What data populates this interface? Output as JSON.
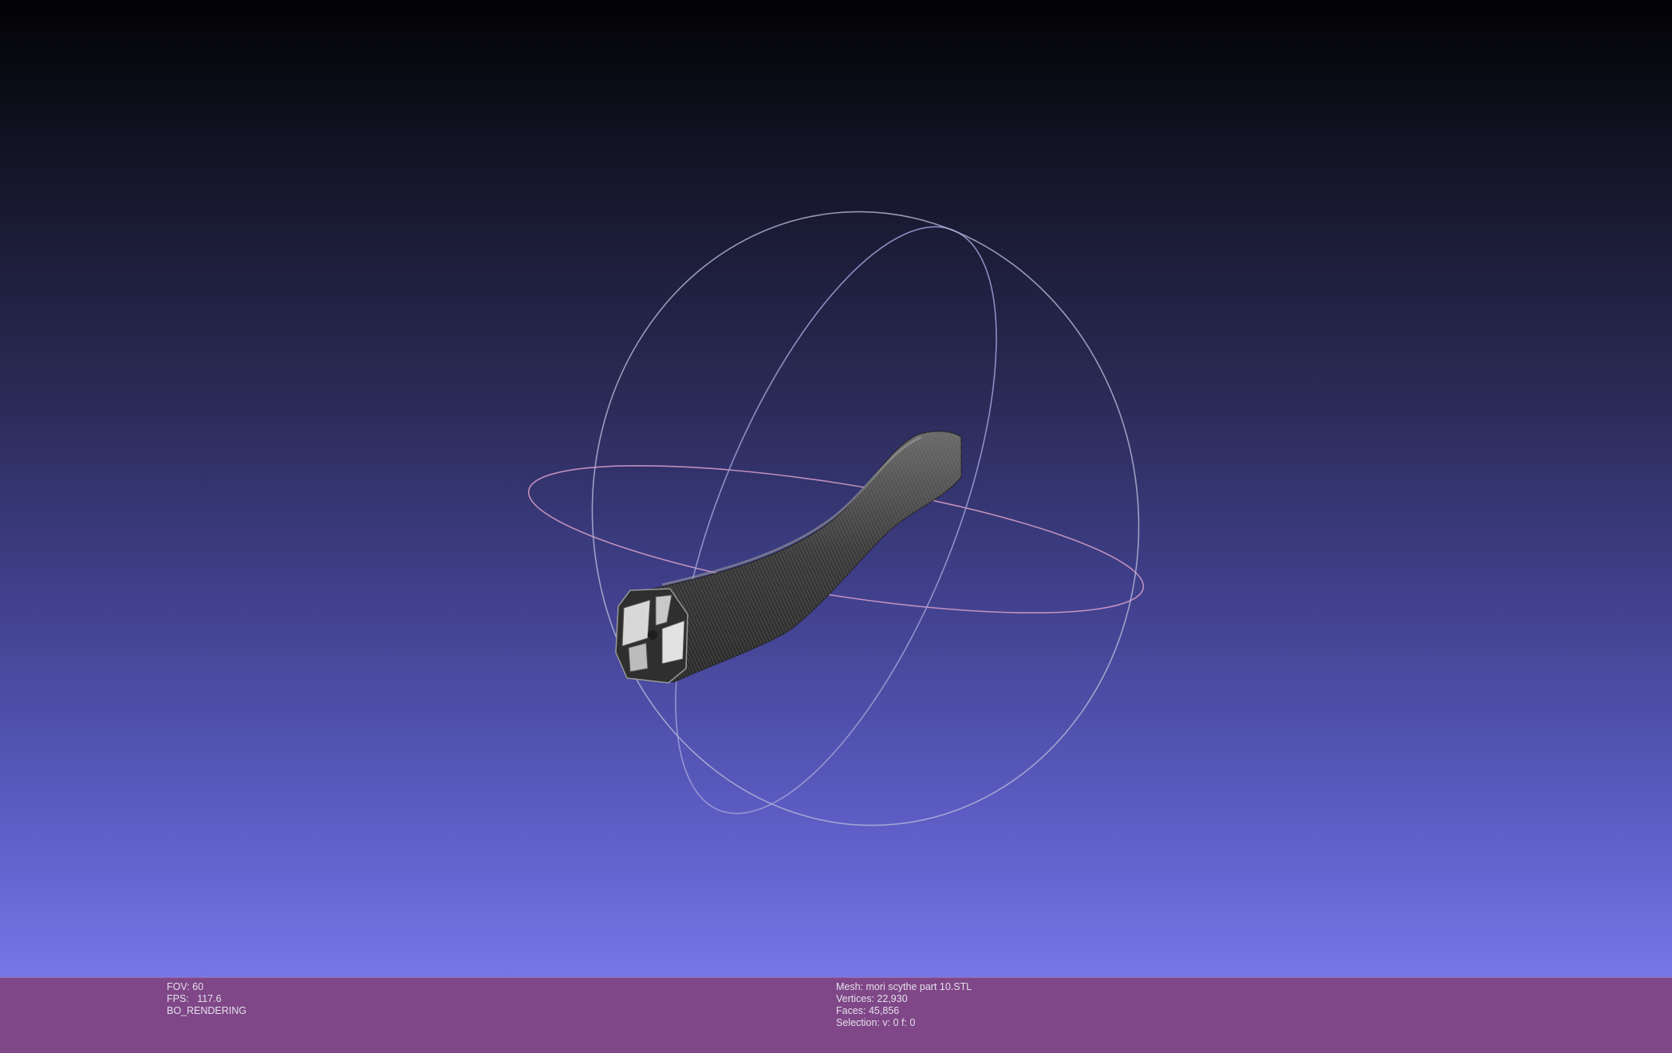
{
  "viewport": {
    "background_top": "#020204",
    "background_bottom": "#7676e8"
  },
  "gizmo": {
    "ring_x_color": "#b8b8d8",
    "ring_y_color": "#9a9ad0",
    "ring_z_color": "#d8a0c8"
  },
  "mesh_model": {
    "color": "#4a4a4a",
    "wire_color": "#8a8a8a",
    "end_cap_color": "#d8d8d8"
  },
  "status": {
    "left": {
      "fov": "FOV: 60",
      "fps": "FPS:   117.6",
      "mode": "BO_RENDERING"
    },
    "right": {
      "mesh": "Mesh: mori scythe part 10.STL",
      "vertices": "Vertices: 22,930",
      "faces": "Faces: 45,856",
      "selection": "Selection: v: 0 f: 0"
    },
    "bar_color": "#7f4787"
  }
}
